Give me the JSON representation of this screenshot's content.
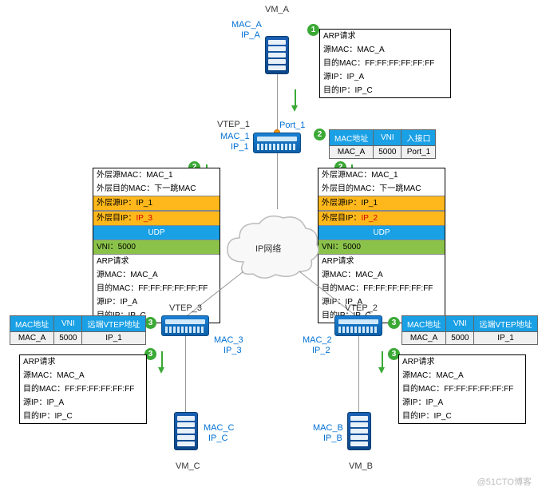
{
  "vm_a": {
    "name": "VM_A",
    "mac": "MAC_A",
    "ip": "IP_A"
  },
  "vm_b": {
    "name": "VM_B",
    "mac": "MAC_B",
    "ip": "IP_B"
  },
  "vm_c": {
    "name": "VM_C",
    "mac": "MAC_C",
    "ip": "IP_C"
  },
  "vtep1": {
    "name": "VTEP_1",
    "mac": "MAC_1",
    "ip": "IP_1",
    "port": "Port_1"
  },
  "vtep2": {
    "name": "VTEP_2",
    "mac": "MAC_2",
    "ip": "IP_2"
  },
  "vtep3": {
    "name": "VTEP_3",
    "mac": "MAC_3",
    "ip": "IP_3"
  },
  "cloud": "IP网络",
  "arp1": {
    "title": "ARP请求",
    "src_mac": "源MAC：MAC_A",
    "dst_mac": "目的MAC：FF:FF:FF:FF:FF:FF",
    "src_ip": "源IP：IP_A",
    "dst_ip": "目的IP：IP_C"
  },
  "pkt_left": {
    "outer_src_mac": "外层源MAC：MAC_1",
    "outer_dst_mac": "外层目的MAC：下一跳MAC",
    "outer_src_ip": "外层源IP：IP_1",
    "outer_dst_ip_label": "外层目IP：",
    "outer_dst_ip": "IP_3",
    "udp": "UDP",
    "vni": "VNI：5000",
    "arp_title": "ARP请求",
    "src_mac": "源MAC：MAC_A",
    "dst_mac": "目的MAC：FF:FF:FF:FF:FF:FF",
    "src_ip": "源IP：IP_A",
    "dst_ip": "目的IP：IP_C"
  },
  "pkt_right": {
    "outer_src_mac": "外层源MAC：MAC_1",
    "outer_dst_mac": "外层目的MAC：下一跳MAC",
    "outer_src_ip": "外层源IP：IP_1",
    "outer_dst_ip_label": "外层目IP：",
    "outer_dst_ip": "IP_2",
    "udp": "UDP",
    "vni": "VNI：5000",
    "arp_title": "ARP请求",
    "src_mac": "源MAC：MAC_A",
    "dst_mac": "目的MAC：FF:FF:FF:FF:FF:FF",
    "src_ip": "源IP：IP_A",
    "dst_ip": "目的IP：IP_C"
  },
  "arp3": {
    "title": "ARP请求",
    "src_mac": "源MAC：MAC_A",
    "dst_mac": "目的MAC：FF:FF:FF:FF:FF:FF",
    "src_ip": "源IP：IP_A",
    "dst_ip": "目的IP：IP_C"
  },
  "table_top": {
    "h1": "MAC地址",
    "h2": "VNI",
    "h3": "入接口",
    "mac": "MAC_A",
    "vni": "5000",
    "port": "Port_1"
  },
  "table_left": {
    "h1": "MAC地址",
    "h2": "VNI",
    "h3": "远端VTEP地址",
    "mac": "MAC_A",
    "vni": "5000",
    "ip": "IP_1"
  },
  "table_right": {
    "h1": "MAC地址",
    "h2": "VNI",
    "h3": "远端VTEP地址",
    "mac": "MAC_A",
    "vni": "5000",
    "ip": "IP_1"
  },
  "steps": {
    "s1": "1",
    "s2": "2",
    "s3": "3"
  },
  "watermark": "@51CTO博客"
}
